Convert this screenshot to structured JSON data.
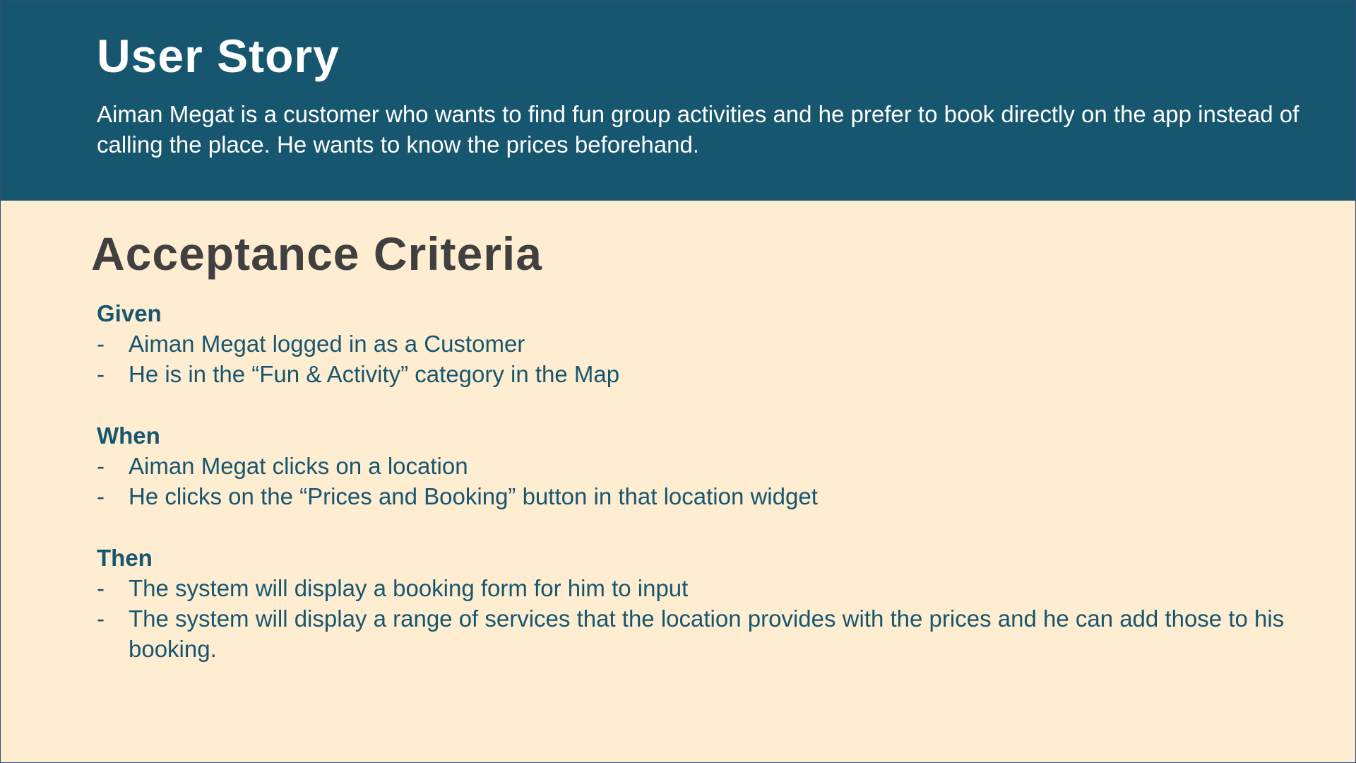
{
  "user_story": {
    "title": "User Story",
    "text": "Aiman Megat is a customer who wants to find fun group activities and he prefer to book directly on the app instead of calling the place. He wants to know the prices beforehand."
  },
  "acceptance_criteria": {
    "title": "Acceptance Criteria",
    "bullet_marker": "-",
    "given": {
      "heading": "Given",
      "items": [
        "Aiman Megat logged in as a Customer",
        "He is in the “Fun & Activity” category in the Map"
      ]
    },
    "when": {
      "heading": "When",
      "items": [
        "Aiman Megat clicks on a location",
        "He clicks on the “Prices and Booking” button in that location widget"
      ]
    },
    "then": {
      "heading": "Then",
      "items": [
        "The system will display a booking form for him to input",
        "The system will display a range of services that the location provides with the prices and he can add those to his booking."
      ]
    }
  },
  "colors": {
    "header_band": "#17566f",
    "background": "#ffedd2",
    "criteria_title": "#404040",
    "criteria_text": "#17566f"
  }
}
